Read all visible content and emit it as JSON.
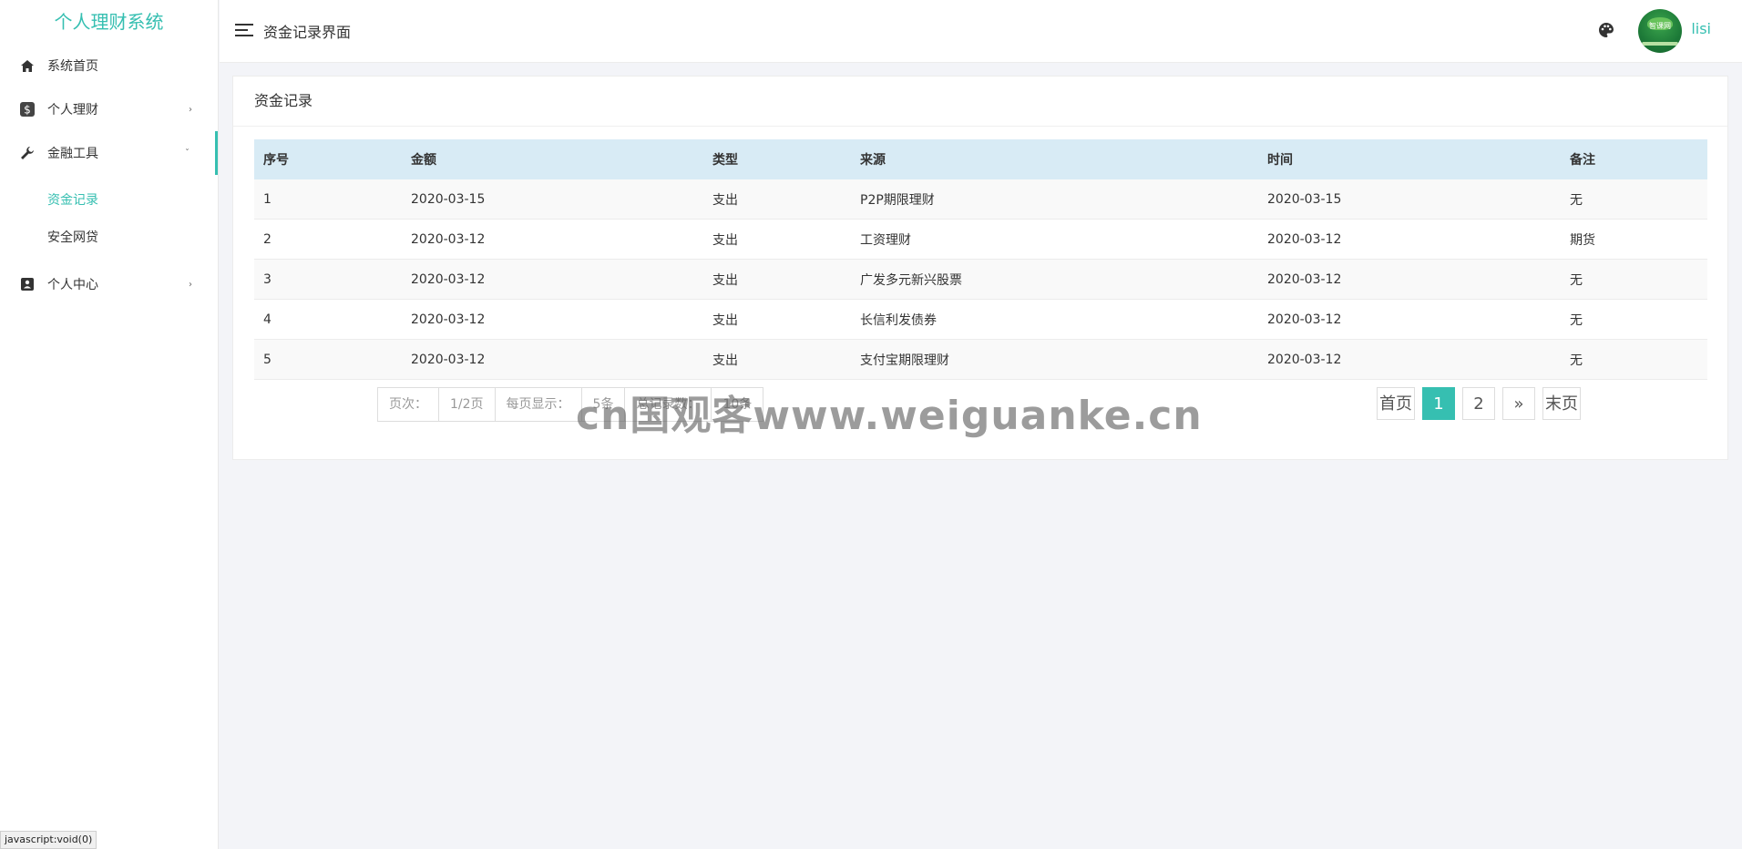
{
  "app": {
    "title": "个人理财系统"
  },
  "sidebar": {
    "items": [
      {
        "label": "系统首页",
        "icon": "home-icon"
      },
      {
        "label": "个人理财",
        "icon": "dollar-icon"
      },
      {
        "label": "金融工具",
        "icon": "wrench-icon",
        "expanded": true,
        "children": [
          {
            "label": "资金记录",
            "active": true
          },
          {
            "label": "安全网贷"
          }
        ]
      },
      {
        "label": "个人中心",
        "icon": "contact-card-icon"
      }
    ]
  },
  "header": {
    "title": "资金记录界面",
    "username": "lisi",
    "avatar_text": "智课网"
  },
  "card": {
    "title": "资金记录"
  },
  "table": {
    "columns": [
      "序号",
      "金额",
      "类型",
      "来源",
      "时间",
      "备注"
    ],
    "rows": [
      [
        "1",
        "2020-03-15",
        "支出",
        "P2P期限理财",
        "2020-03-15",
        "无"
      ],
      [
        "2",
        "2020-03-12",
        "支出",
        "工资理财",
        "2020-03-12",
        "期货"
      ],
      [
        "3",
        "2020-03-12",
        "支出",
        "广发多元新兴股票",
        "2020-03-12",
        "无"
      ],
      [
        "4",
        "2020-03-12",
        "支出",
        "长信利发债券",
        "2020-03-12",
        "无"
      ],
      [
        "5",
        "2020-03-12",
        "支出",
        "支付宝期限理财",
        "2020-03-12",
        "无"
      ]
    ]
  },
  "pagination": {
    "page_label": "页次：",
    "page_value": "1/2页",
    "per_page_label": "每页显示：",
    "per_page_value": "5",
    "per_unit": "条",
    "total_label": "总记录数：",
    "total_value": "10条",
    "first": "首页",
    "pages": [
      "1",
      "2"
    ],
    "current": "1",
    "next": "»",
    "last": "末页"
  },
  "watermark": "cn国观客www.weiguanke.cn",
  "status_bar": "javascript:void(0)",
  "colors": {
    "accent": "#36bfb1",
    "table_header": "#d8ebf5",
    "background": "#f3f4f8"
  }
}
